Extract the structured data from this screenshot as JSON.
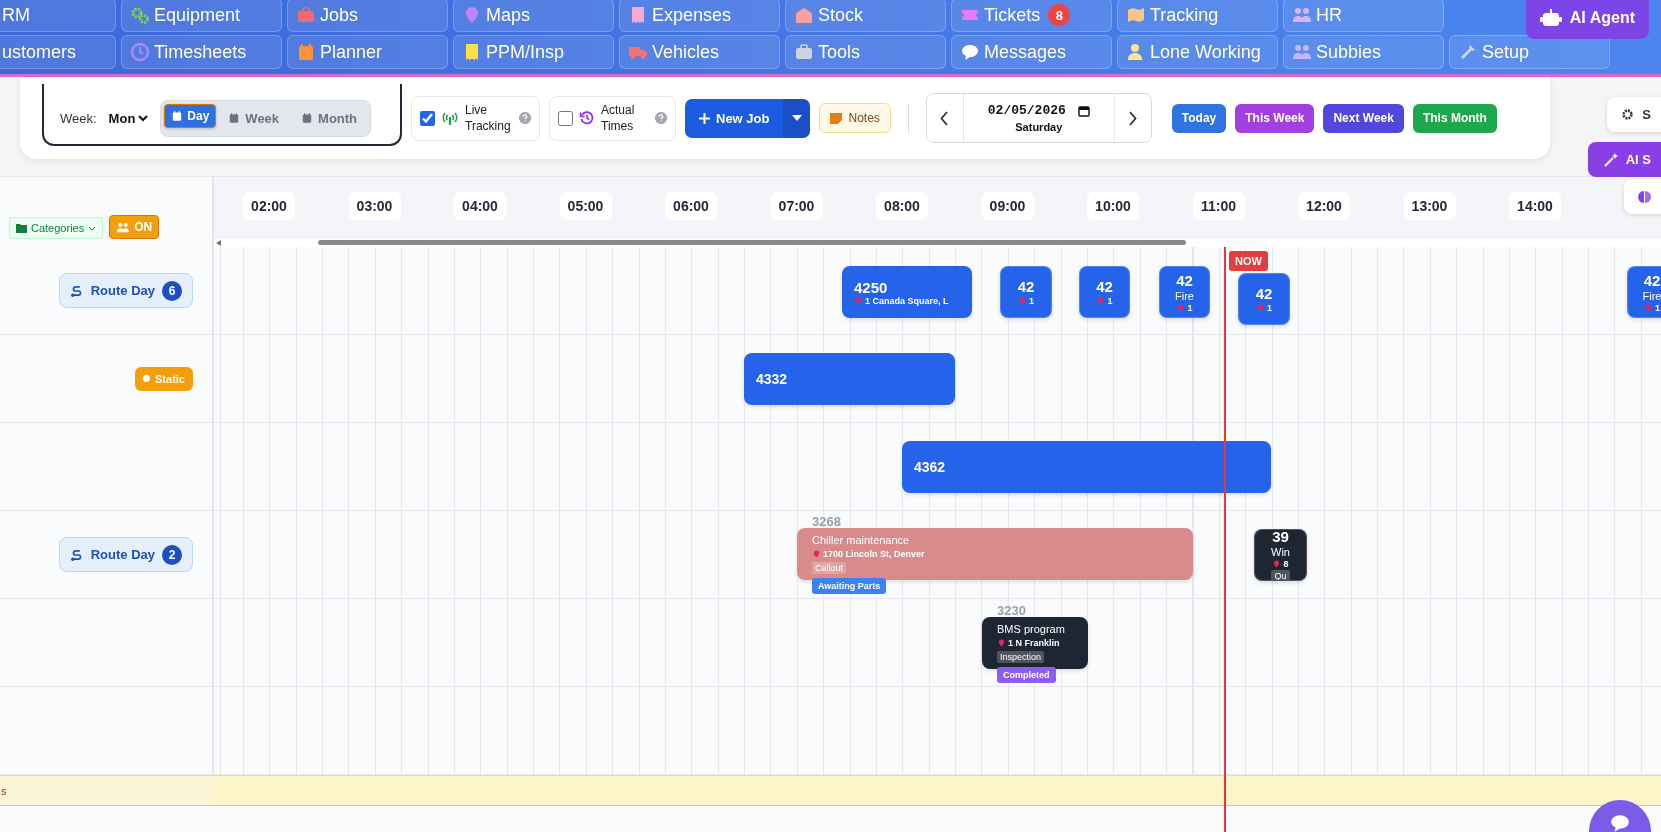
{
  "nav": {
    "rows": [
      [
        {
          "label": "RM"
        },
        {
          "label": "Equipment"
        },
        {
          "label": "Jobs"
        },
        {
          "label": "Maps"
        },
        {
          "label": "Expenses"
        },
        {
          "label": "Stock"
        },
        {
          "label": "Tickets",
          "badge": "8"
        },
        {
          "label": "Tracking"
        },
        {
          "label": "HR"
        }
      ],
      [
        {
          "label": "ustomers"
        },
        {
          "label": "Timesheets"
        },
        {
          "label": "Planner"
        },
        {
          "label": "PPM/Insp"
        },
        {
          "label": "Vehicles"
        },
        {
          "label": "Tools"
        },
        {
          "label": "Messages"
        },
        {
          "label": "Lone Working"
        },
        {
          "label": "Subbies"
        },
        {
          "label": "Setup"
        }
      ]
    ],
    "ai_agent": "AI Agent"
  },
  "toolbar": {
    "week_label": "Week:",
    "week_start": "Mon",
    "views": [
      {
        "label": "Day",
        "selected": true
      },
      {
        "label": "Week",
        "selected": false
      },
      {
        "label": "Month",
        "selected": false
      }
    ],
    "live_tracking": {
      "label": "Live Tracking",
      "checked": true
    },
    "actual_times": {
      "label": "Actual Times",
      "checked": false
    },
    "new_job": "New Job",
    "notes": "Notes",
    "date": {
      "value": "02/05/2026",
      "weekday": "Saturday"
    },
    "quick_ranges": [
      {
        "label": "Today",
        "color": "#2f74e0"
      },
      {
        "label": "This Week",
        "color": "#a33fe0"
      },
      {
        "label": "Next Week",
        "color": "#5146dd"
      },
      {
        "label": "This Month",
        "color": "#1ea64c"
      }
    ]
  },
  "side_buttons": [
    {
      "kind": "settings",
      "label": "S"
    },
    {
      "kind": "ai",
      "label": "AI S"
    },
    {
      "kind": "brain"
    }
  ],
  "scheduler": {
    "filter": "Categories",
    "toggle": "ON",
    "hours": [
      "02:00",
      "03:00",
      "04:00",
      "05:00",
      "06:00",
      "07:00",
      "08:00",
      "09:00",
      "10:00",
      "11:00",
      "12:00",
      "13:00",
      "14:00"
    ],
    "now_label": "NOW",
    "rows": [
      {
        "badge": {
          "kind": "route",
          "label": "Route Day",
          "count": "6"
        },
        "jobs": [
          {
            "kind": "card",
            "number": "4250",
            "address": "1 Canada Square, L",
            "color": "#2563eb"
          },
          {
            "kind": "tile",
            "number": "42",
            "address": "1",
            "color": "#2563eb"
          },
          {
            "kind": "tile",
            "number": "42",
            "address": "1",
            "color": "#2563eb"
          },
          {
            "kind": "tile",
            "number": "42",
            "title": "Fire",
            "address": "1",
            "color": "#2563eb"
          },
          {
            "kind": "tile",
            "number": "42",
            "address": "1",
            "color": "#2563eb"
          },
          {
            "kind": "tile",
            "number": "42",
            "title": "Fire",
            "address": "1",
            "color": "#2563eb"
          }
        ]
      },
      {
        "badge": {
          "kind": "static",
          "label": "Static"
        },
        "jobs": [
          {
            "kind": "bar",
            "number": "4332",
            "color": "#2563eb"
          }
        ]
      },
      {
        "jobs": [
          {
            "kind": "bar",
            "number": "4362",
            "color": "#2563eb"
          }
        ]
      },
      {
        "badge": {
          "kind": "route",
          "label": "Route Day",
          "count": "2"
        },
        "jobs": [
          {
            "kind": "detailed",
            "number": "3268",
            "title": "Chiller maintenance",
            "address": "1700 Lincoln St, Denver",
            "tag": "Callout",
            "status": {
              "label": "Awaiting Parts",
              "color": "#3b82f6"
            },
            "color": "#d98b8b"
          },
          {
            "kind": "tile",
            "number": "39",
            "title": "Win",
            "address": "8",
            "tag": "Qu",
            "color": "#1e2533"
          }
        ]
      },
      {
        "jobs": [
          {
            "kind": "detailed",
            "number": "3230",
            "title": "BMS program",
            "address": "1 N Franklin",
            "tag": "Inspection",
            "status": {
              "label": "Completed",
              "color": "#8b5cf6"
            },
            "color": "#1e2533"
          }
        ]
      },
      {}
    ],
    "footer_label": "s"
  }
}
